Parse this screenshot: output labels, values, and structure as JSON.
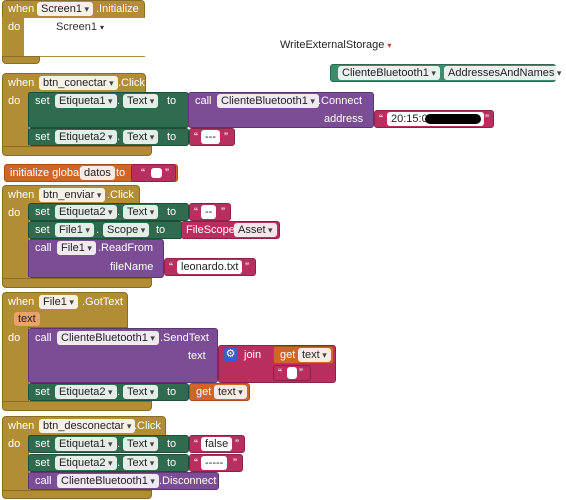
{
  "kw": {
    "when": "when",
    "do": "do",
    "set": "set",
    "to": "to",
    "call": "call",
    "initialize": "initialize global",
    "get": "get",
    "join": "join",
    "dot": "."
  },
  "b1": {
    "comp": "Screen1",
    "event": ".Initialize",
    "inner_comp": "Screen1",
    "permission": "WriteExternalStorage"
  },
  "addr_block": {
    "comp": "ClienteBluetooth1",
    "prop": "AddressesAndNames"
  },
  "b2": {
    "comp": "btn_conectar",
    "event": ".Click",
    "set1": {
      "comp": "Etiqueta1",
      "prop": "Text"
    },
    "call_comp": "ClienteBluetooth1",
    "call_method": ".Connect",
    "param": "address",
    "address_value": "20:15:0",
    "set2": {
      "comp": "Etiqueta2",
      "prop": "Text",
      "value": "---"
    }
  },
  "g": {
    "name": "datos"
  },
  "b3": {
    "comp": "btn_enviar",
    "event": ".Click",
    "set1": {
      "comp": "Etiqueta2",
      "prop": "Text",
      "value": "--"
    },
    "set2": {
      "comp": "File1",
      "prop": "Scope",
      "scope_label": "FileScope",
      "scope_value": "Asset"
    },
    "call_comp": "File1",
    "call_method": ".ReadFrom",
    "param": "fileName",
    "file_value": "leonardo.txt"
  },
  "b4": {
    "comp": "File1",
    "event": ".GotText",
    "param": "text",
    "call_comp": "ClienteBluetooth1",
    "call_method": ".SendText",
    "call_param": "text",
    "get_var": "text",
    "join_second": " ",
    "set1": {
      "comp": "Etiqueta2",
      "prop": "Text"
    },
    "get2_var": "text"
  },
  "b5": {
    "comp": "btn_desconectar",
    "event": ".Click",
    "set1": {
      "comp": "Etiqueta1",
      "prop": "Text",
      "value": "false"
    },
    "set2": {
      "comp": "Etiqueta2",
      "prop": "Text",
      "value": "-----"
    },
    "call_comp": "ClienteBluetooth1",
    "call_method": ".Disconnect"
  },
  "colors": {
    "event": "#b18e35",
    "set": "#2f6b4e",
    "call": "#7b4d94",
    "text": "#b82f5f",
    "variable": "#d0652a",
    "component": "#3c8d6b"
  }
}
